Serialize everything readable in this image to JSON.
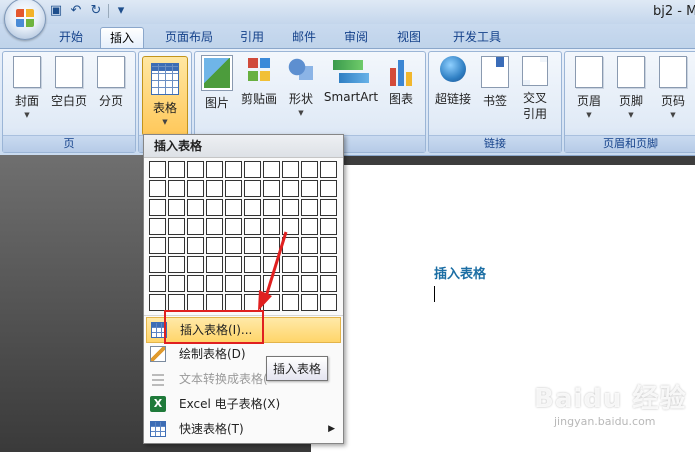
{
  "window": {
    "title": "bj2 - M"
  },
  "quick_access": {
    "icons": [
      "save-icon",
      "undo-icon",
      "redo-icon",
      "customize-icon"
    ]
  },
  "tabs": [
    "开始",
    "插入",
    "页面布局",
    "引用",
    "邮件",
    "审阅",
    "视图",
    "开发工具"
  ],
  "active_tab": "插入",
  "ribbon": {
    "groups": {
      "pages": {
        "label": "页",
        "buttons": [
          "封面",
          "空白页",
          "分页"
        ]
      },
      "tables": {
        "buttons": [
          "表格"
        ]
      },
      "illustrations": {
        "buttons": [
          "图片",
          "剪贴画",
          "形状",
          "SmartArt",
          "图表"
        ]
      },
      "links": {
        "label": "链接",
        "buttons": [
          "超链接",
          "书签",
          "交叉引用"
        ]
      },
      "header_footer": {
        "label": "页眉和页脚",
        "buttons": [
          "页眉",
          "页脚",
          "页码"
        ]
      }
    }
  },
  "dropdown": {
    "title": "插入表格",
    "grid": {
      "columns": 10,
      "rows": 8
    },
    "items": [
      {
        "label": "插入表格(I)...",
        "icon": "insert-table-icon",
        "highlighted": true
      },
      {
        "label": "绘制表格(D)",
        "icon": "draw-table-icon"
      },
      {
        "label": "文本转换成表格(",
        "icon": "convert-text-icon",
        "disabled": true
      },
      {
        "label": "Excel 电子表格(X)",
        "icon": "excel-icon"
      },
      {
        "label": "快速表格(T)",
        "icon": "quick-table-icon",
        "submenu": true
      }
    ]
  },
  "tooltip": "插入表格",
  "document": {
    "heading": "插入表格"
  },
  "watermark": {
    "logo": "Baidu 经验",
    "url": "jingyan.baidu.com"
  },
  "colors": {
    "accent": "#15428b",
    "highlight": "#ffd56a",
    "annotation": "#e02020",
    "heading": "#1c6ea4"
  }
}
